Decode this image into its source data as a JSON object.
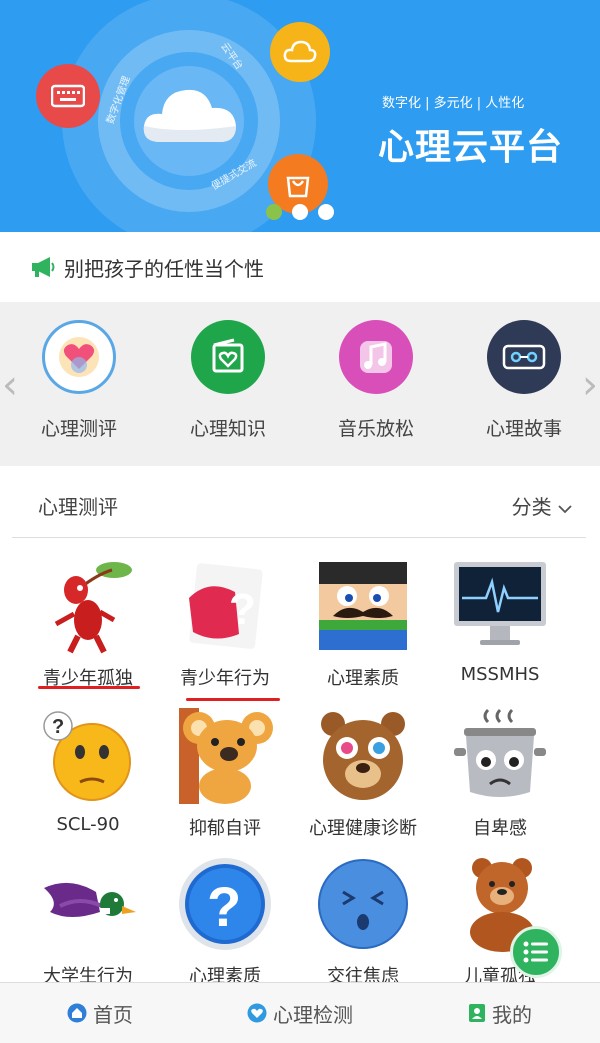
{
  "banner": {
    "subtitle": "数字化 | 多元化 | 人性化",
    "title": "心理云平台",
    "ring_labels": [
      "数字化管理",
      "云平台",
      "便捷式交流"
    ],
    "slide_count": 3,
    "active_slide": 1,
    "colors": {
      "background": "#2e9cf0",
      "red": "#e84a4a",
      "yellow": "#f6b419",
      "orange": "#f47b1f",
      "active_dot": "#8bc34a"
    }
  },
  "notice": {
    "icon": "megaphone-icon",
    "text": "别把孩子的任性当个性"
  },
  "quick_nav": [
    {
      "label": "心理测评",
      "icon": "heart-circle-icon"
    },
    {
      "label": "心理知识",
      "icon": "book-heart-icon"
    },
    {
      "label": "音乐放松",
      "icon": "music-note-icon"
    },
    {
      "label": "心理故事",
      "icon": "cassette-tape-icon"
    }
  ],
  "section": {
    "title": "心理测评",
    "sort_label": "分类",
    "items": [
      {
        "label": "青少年孤独",
        "icon": "red-creature-leaf-icon"
      },
      {
        "label": "青少年行为",
        "icon": "question-card-icon"
      },
      {
        "label": "心理素质",
        "icon": "mustache-face-icon"
      },
      {
        "label": "MSSMHS",
        "icon": "computer-monitor-icon"
      },
      {
        "label": "SCL-90",
        "icon": "confused-smiley-icon"
      },
      {
        "label": "抑郁自评",
        "icon": "koala-icon"
      },
      {
        "label": "心理健康诊断",
        "icon": "dizzy-bear-icon"
      },
      {
        "label": "自卑感",
        "icon": "steaming-pot-face-icon"
      },
      {
        "label": "大学生行为",
        "icon": "duck-icon"
      },
      {
        "label": "心理素质",
        "icon": "blue-question-badge-icon"
      },
      {
        "label": "交往焦虑",
        "icon": "anxious-blue-face-icon"
      },
      {
        "label": "儿童孤独",
        "icon": "sad-bear-icon"
      }
    ]
  },
  "fab": {
    "icon": "menu-list-icon"
  },
  "tabbar": [
    {
      "label": "首页",
      "icon": "home-icon"
    },
    {
      "label": "心理检测",
      "icon": "heart-badge-icon"
    },
    {
      "label": "我的",
      "icon": "user-card-icon"
    }
  ]
}
